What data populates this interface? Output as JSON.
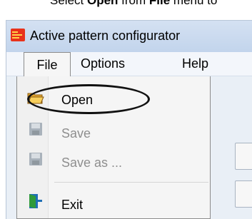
{
  "caption": {
    "prefix": "Select ",
    "item_bold": "Open",
    "middle": " from ",
    "menu_bold": "File",
    "suffix": " menu to"
  },
  "window": {
    "title": "Active pattern configurator"
  },
  "menubar": {
    "items": [
      {
        "label": "File"
      },
      {
        "label": "Options"
      },
      {
        "label": "Help"
      }
    ]
  },
  "file_menu": {
    "items": [
      {
        "label": "Open",
        "icon": "open-folder-icon",
        "enabled": true,
        "highlighted": true
      },
      {
        "label": "Save",
        "icon": "floppy-disk-icon",
        "enabled": false
      },
      {
        "label": "Save as ...",
        "icon": "floppy-disk-icon",
        "enabled": false
      },
      {
        "label": "Exit",
        "icon": "exit-door-icon",
        "enabled": true
      }
    ]
  },
  "colors": {
    "accent": "#e8321b",
    "highlight_ring": "#111111",
    "disabled_text": "#8e8e8e"
  }
}
